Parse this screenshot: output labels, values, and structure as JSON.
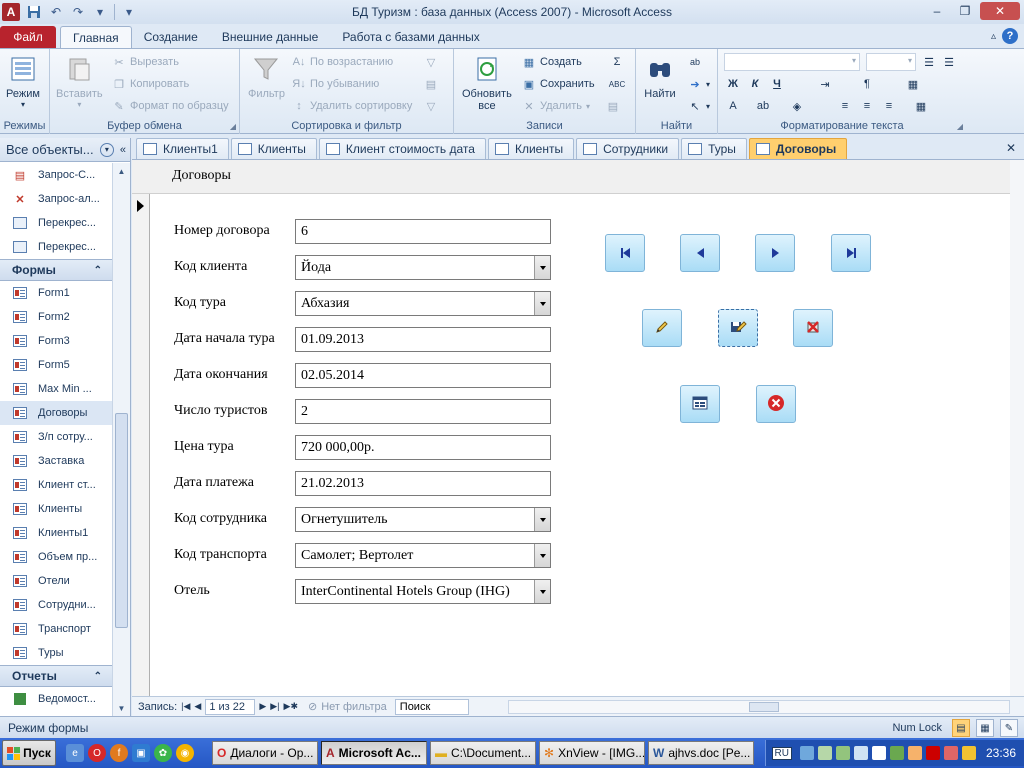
{
  "window": {
    "title": "БД Туризм : база данных (Access 2007)  -  Microsoft Access"
  },
  "ribbon_tabs": {
    "file": "Файл",
    "tabs": [
      "Главная",
      "Создание",
      "Внешние данные",
      "Работа с базами данных"
    ]
  },
  "ribbon": {
    "modes": {
      "view": "Режим",
      "label": "Режимы"
    },
    "clipboard": {
      "paste": "Вставить",
      "cut": "Вырезать",
      "copy": "Копировать",
      "format_painter": "Формат по образцу",
      "label": "Буфер обмена"
    },
    "sort_filter": {
      "filter": "Фильтр",
      "ascending": "По возрастанию",
      "descending": "По убыванию",
      "remove_sort": "Удалить сортировку",
      "label": "Сортировка и фильтр"
    },
    "records": {
      "refresh_line1": "Обновить",
      "refresh_line2": "все",
      "new": "Создать",
      "save": "Сохранить",
      "delete": "Удалить",
      "label": "Записи"
    },
    "find": {
      "find": "Найти",
      "label": "Найти"
    },
    "text_format": {
      "bold": "Ж",
      "italic": "К",
      "underline": "Ч",
      "label": "Форматирование текста"
    }
  },
  "nav_pane": {
    "header": "Все объекты...",
    "query_items": [
      "Запрос-С...",
      "Запрос-ал...",
      "Перекрес...",
      "Перекрес..."
    ],
    "forms_section": "Формы",
    "form_items": [
      "Form1",
      "Form2",
      "Form3",
      "Form5",
      "Max Min ...",
      "Договоры",
      "З/п сотру...",
      "Заставка",
      "Клиент ст...",
      "Клиенты",
      "Клиенты1",
      "Объем пр...",
      "Отели",
      "Сотрудни...",
      "Транспорт",
      "Туры"
    ],
    "selected_form": "Договоры",
    "reports_section": "Отчеты",
    "report_items": [
      "Ведомост..."
    ]
  },
  "doc_tabs": [
    {
      "label": "Клиенты1",
      "active": false
    },
    {
      "label": "Клиенты",
      "active": false
    },
    {
      "label": "Клиент стоимость дата",
      "active": false
    },
    {
      "label": "Клиенты",
      "active": false
    },
    {
      "label": "Сотрудники",
      "active": false
    },
    {
      "label": "Туры",
      "active": false
    },
    {
      "label": "Договоры",
      "active": true
    }
  ],
  "form": {
    "title": "Договоры",
    "fields": [
      {
        "label": "Номер договора",
        "value": "6",
        "combo": false
      },
      {
        "label": "Код клиента",
        "value": "Йода",
        "combo": true
      },
      {
        "label": "Код тура",
        "value": "Абхазия",
        "combo": true
      },
      {
        "label": "Дата начала тура",
        "value": "01.09.2013",
        "combo": false
      },
      {
        "label": "Дата окончания",
        "value": "02.05.2014",
        "combo": false
      },
      {
        "label": "Число туристов",
        "value": "2",
        "combo": false
      },
      {
        "label": "Цена тура",
        "value": "720 000,00р.",
        "combo": false
      },
      {
        "label": "Дата платежа",
        "value": "21.02.2013",
        "combo": false
      },
      {
        "label": "Код сотрудника",
        "value": "Огнетушитель",
        "combo": true
      },
      {
        "label": "Код транспорта",
        "value": "Самолет; Вертолет",
        "combo": true
      },
      {
        "label": "Отель",
        "value": "InterContinental Hotels Group (IHG)",
        "combo": true
      }
    ]
  },
  "record_nav": {
    "label": "Запись:",
    "position": "1 из 22",
    "filter": "Нет фильтра",
    "search": "Поиск"
  },
  "status": {
    "mode": "Режим формы",
    "numlock": "Num Lock"
  },
  "taskbar": {
    "start": "Пуск",
    "tasks": [
      {
        "label": "Диалоги - Op...",
        "active": false
      },
      {
        "label": "Microsoft Ac...",
        "active": true
      },
      {
        "label": "C:\\Document...",
        "active": false
      },
      {
        "label": "XnView - [IMG...",
        "active": false
      },
      {
        "label": "ajhvs.doc [Pe...",
        "active": false
      }
    ],
    "lang": "RU",
    "clock": "23:36"
  },
  "colors": {
    "file_tab": "#b8232d",
    "active_doc_tab": "#ffcf6e",
    "nav_button": "#a9dcf6",
    "taskbar": "#2557c4"
  }
}
